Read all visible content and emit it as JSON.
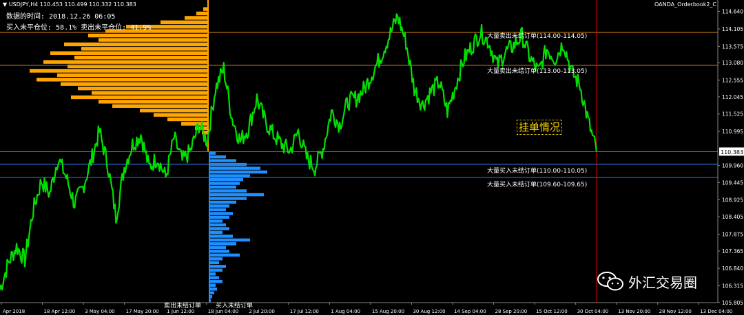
{
  "header": {
    "symbol_line": "▼ USDJPY,H4  110.453 110.499 110.332 110.383",
    "data_time": "数据的时间: 2018.12.26 06:05",
    "position_ratio": "买入未平仓位: 58.1%  卖出未平仓位: 41.9%",
    "indicator_name": "OANDA_Orderbook2_C"
  },
  "labels": {
    "big_sell_1": "大量卖出未结订单(114.00-114.05)",
    "big_sell_2": "大量卖出未结订单(113.00-113.05)",
    "big_buy_1": "大量买入未结订单(110.00-110.05)",
    "big_buy_2": "大量买入未结订单(109.60-109.65)",
    "order_status": "挂单情况",
    "sell_orders": "卖出未结订单",
    "buy_orders": "买入未结订单",
    "watermark": "外汇交易圈"
  },
  "colors": {
    "price_line": "#00e000",
    "sell_histogram": "#ffa500",
    "buy_histogram": "#1e90ff",
    "resistance_line": "#c87814",
    "support_line": "#2a6fd6",
    "current_price_badge": "#ffffff"
  },
  "chart_data": {
    "type": "line",
    "symbol": "USDJPY",
    "timeframe": "H4",
    "current_price": 110.383,
    "ylim": [
      105.8,
      114.9
    ],
    "y_ticks": [
      "114.640",
      "114.105",
      "113.575",
      "113.080",
      "112.555",
      "112.045",
      "111.525",
      "110.995",
      "110.383",
      "109.960",
      "109.445",
      "108.925",
      "108.405",
      "107.875",
      "107.365",
      "106.840",
      "106.315",
      "105.805"
    ],
    "x_ticks": [
      "Apr 2018",
      "18 Apr 12:00",
      "3 May 04:00",
      "17 May 20:00",
      "1 Jun 12:00",
      "18 Jun 04:00",
      "2 Jul 20:00",
      "17 Jul 12:00",
      "1 Aug 04:00",
      "15 Aug 20:00",
      "30 Aug 12:00",
      "14 Sep 04:00",
      "28 Sep 20:00",
      "15 Oct 12:00",
      "30 Oct 04:00",
      "13 Nov 20:00",
      "28 Nov 12:00",
      "13 Dec 04:00"
    ],
    "price_path": [
      106.2,
      107.0,
      107.5,
      107.1,
      108.6,
      109.5,
      109.1,
      110.2,
      109.6,
      108.8,
      109.3,
      110.1,
      111.0,
      110.0,
      108.4,
      109.9,
      110.6,
      110.9,
      109.9,
      110.2,
      109.6,
      110.8,
      110.1,
      110.4,
      111.2,
      110.7,
      112.3,
      112.9,
      111.4,
      110.7,
      111.1,
      112.0,
      111.3,
      110.9,
      110.6,
      110.4,
      111.0,
      110.2,
      109.9,
      110.5,
      111.6,
      111.2,
      111.9,
      112.0,
      112.3,
      112.8,
      113.3,
      113.9,
      114.5,
      113.7,
      112.3,
      111.8,
      112.2,
      112.5,
      111.6,
      112.4,
      113.2,
      113.6,
      114.0,
      113.7,
      113.0,
      113.4,
      113.6,
      113.9,
      113.2,
      112.8,
      113.5,
      113.2,
      113.7,
      112.8,
      112.4,
      111.3,
      110.383
    ],
    "resistance_levels": [
      114.0,
      113.0
    ],
    "support_levels": [
      110.0,
      109.6
    ],
    "sell_orders_histogram": [
      2,
      8,
      18,
      35,
      70,
      120,
      150,
      175,
      160,
      210,
      185,
      230,
      195,
      240,
      205,
      260,
      220,
      250,
      215,
      190,
      170,
      200,
      160,
      140,
      100,
      80,
      60,
      40,
      20,
      10
    ],
    "buy_orders_histogram": [
      10,
      25,
      40,
      55,
      75,
      85,
      60,
      50,
      45,
      40,
      55,
      80,
      55,
      40,
      30,
      25,
      35,
      30,
      20,
      25,
      30,
      20,
      35,
      60,
      40,
      25,
      30,
      45,
      20,
      15,
      25,
      20,
      10,
      15,
      20,
      10,
      12,
      8,
      5,
      3
    ]
  }
}
